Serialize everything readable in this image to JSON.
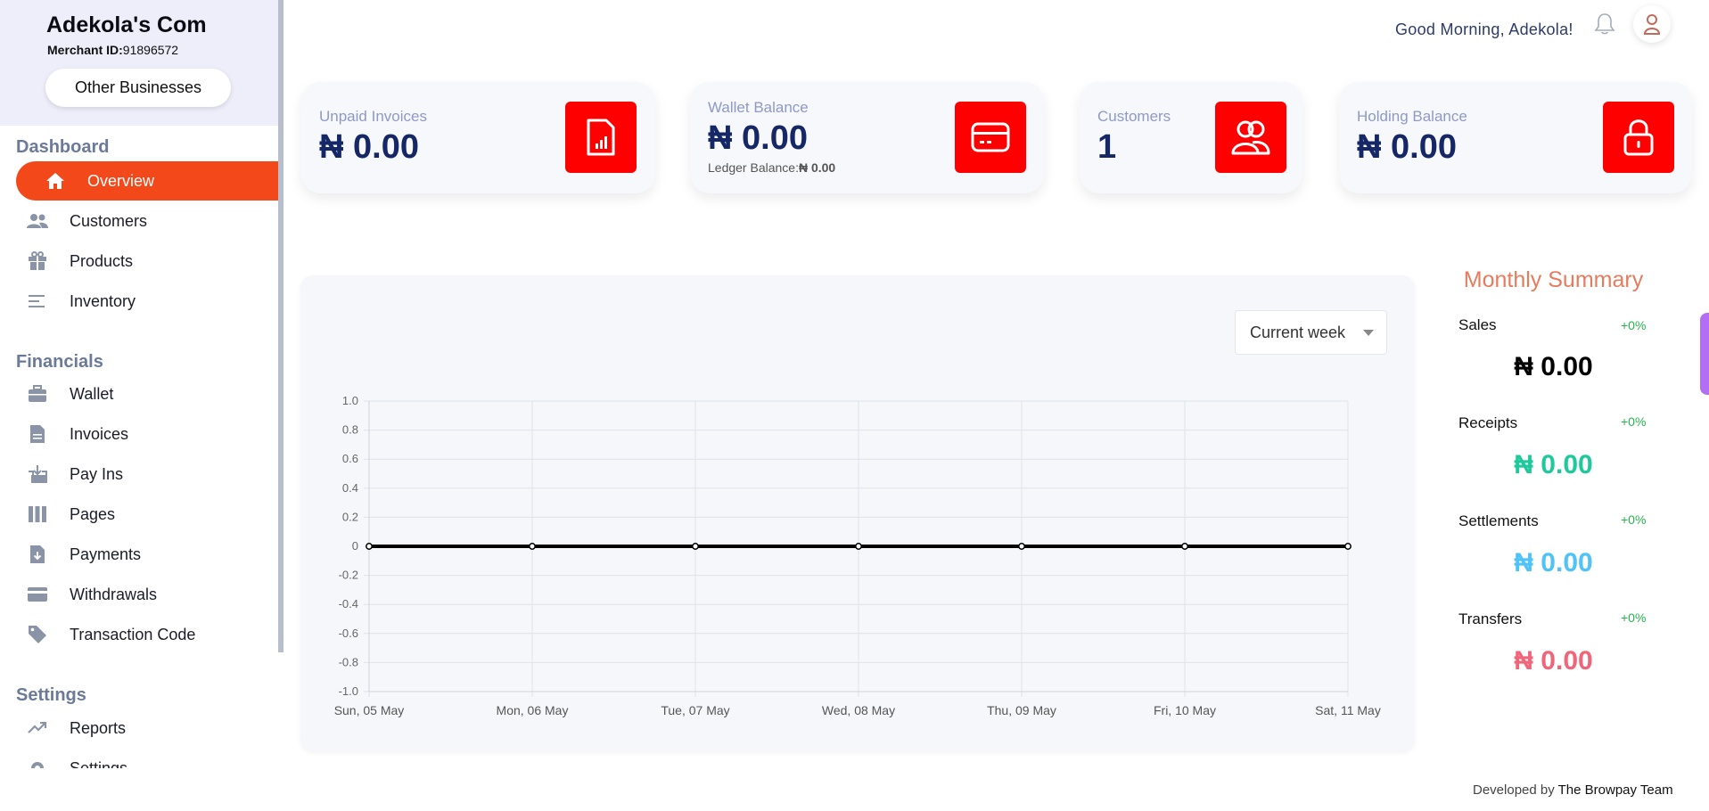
{
  "brand": {
    "name": "Adekola's Com",
    "merchant_label": "Merchant ID:",
    "merchant_id": "91896572",
    "other_businesses": "Other Businesses"
  },
  "sidebar": {
    "sections": [
      {
        "title": "Dashboard",
        "items": [
          {
            "label": "Overview",
            "icon": "home-icon",
            "active": true
          },
          {
            "label": "Customers",
            "icon": "users-icon"
          },
          {
            "label": "Products",
            "icon": "gift-icon"
          },
          {
            "label": "Inventory",
            "icon": "list-icon"
          }
        ]
      },
      {
        "title": "Financials",
        "items": [
          {
            "label": "Wallet",
            "icon": "briefcase-icon"
          },
          {
            "label": "Invoices",
            "icon": "document-icon"
          },
          {
            "label": "Pay Ins",
            "icon": "inbox-download-icon"
          },
          {
            "label": "Pages",
            "icon": "columns-icon"
          },
          {
            "label": "Payments",
            "icon": "file-download-icon"
          },
          {
            "label": "Withdrawals",
            "icon": "credit-card-icon"
          },
          {
            "label": "Transaction Code",
            "icon": "tag-icon"
          }
        ]
      },
      {
        "title": "Settings",
        "items": [
          {
            "label": "Reports",
            "icon": "trend-icon"
          },
          {
            "label": "Settings",
            "icon": "gear-icon"
          }
        ]
      }
    ]
  },
  "header": {
    "greeting": "Good Morning, Adekola!"
  },
  "cards": [
    {
      "label": "Unpaid Invoices",
      "value": "₦ 0.00",
      "icon": "invoice-chart-icon"
    },
    {
      "label": "Wallet Balance",
      "value": "₦ 0.00",
      "sub_label": "Ledger Balance:",
      "sub_value": "₦ 0.00",
      "icon": "card-icon"
    },
    {
      "label": "Customers",
      "value": "1",
      "icon": "users-icon"
    },
    {
      "label": "Holding Balance",
      "value": "₦ 0.00",
      "icon": "lock-icon"
    }
  ],
  "chart_filter": {
    "selected": "Current week"
  },
  "chart_data": {
    "type": "line",
    "categories": [
      "Sun, 05 May",
      "Mon, 06 May",
      "Tue, 07 May",
      "Wed, 08 May",
      "Thu, 09 May",
      "Fri, 10 May",
      "Sat, 11 May"
    ],
    "series": [
      {
        "values": [
          0,
          0,
          0,
          0,
          0,
          0,
          0
        ],
        "color": "#000000"
      }
    ],
    "y_ticks": [
      "1.0",
      "0.8",
      "0.6",
      "0.4",
      "0.2",
      "0",
      "-0.2",
      "-0.4",
      "-0.6",
      "-0.8",
      "-1.0"
    ],
    "ylim": [
      -1,
      1
    ],
    "grid": true,
    "legend": "none"
  },
  "summary": {
    "title": "Monthly Summary",
    "items": [
      {
        "label": "Sales",
        "pct": "+0%",
        "value": "₦ 0.00",
        "color": "#000000"
      },
      {
        "label": "Receipts",
        "pct": "+0%",
        "value": "₦ 0.00",
        "color": "#1ec99b"
      },
      {
        "label": "Settlements",
        "pct": "+0%",
        "value": "₦ 0.00",
        "color": "#4fc3f7"
      },
      {
        "label": "Transfers",
        "pct": "+0%",
        "value": "₦ 0.00",
        "color": "#f0657a"
      }
    ]
  },
  "footer": {
    "prefix": "Developed by",
    "team": "The Browpay Team"
  },
  "colors": {
    "accent": "#f3481a",
    "icon_bg": "#ff0000",
    "navy": "#152766"
  }
}
